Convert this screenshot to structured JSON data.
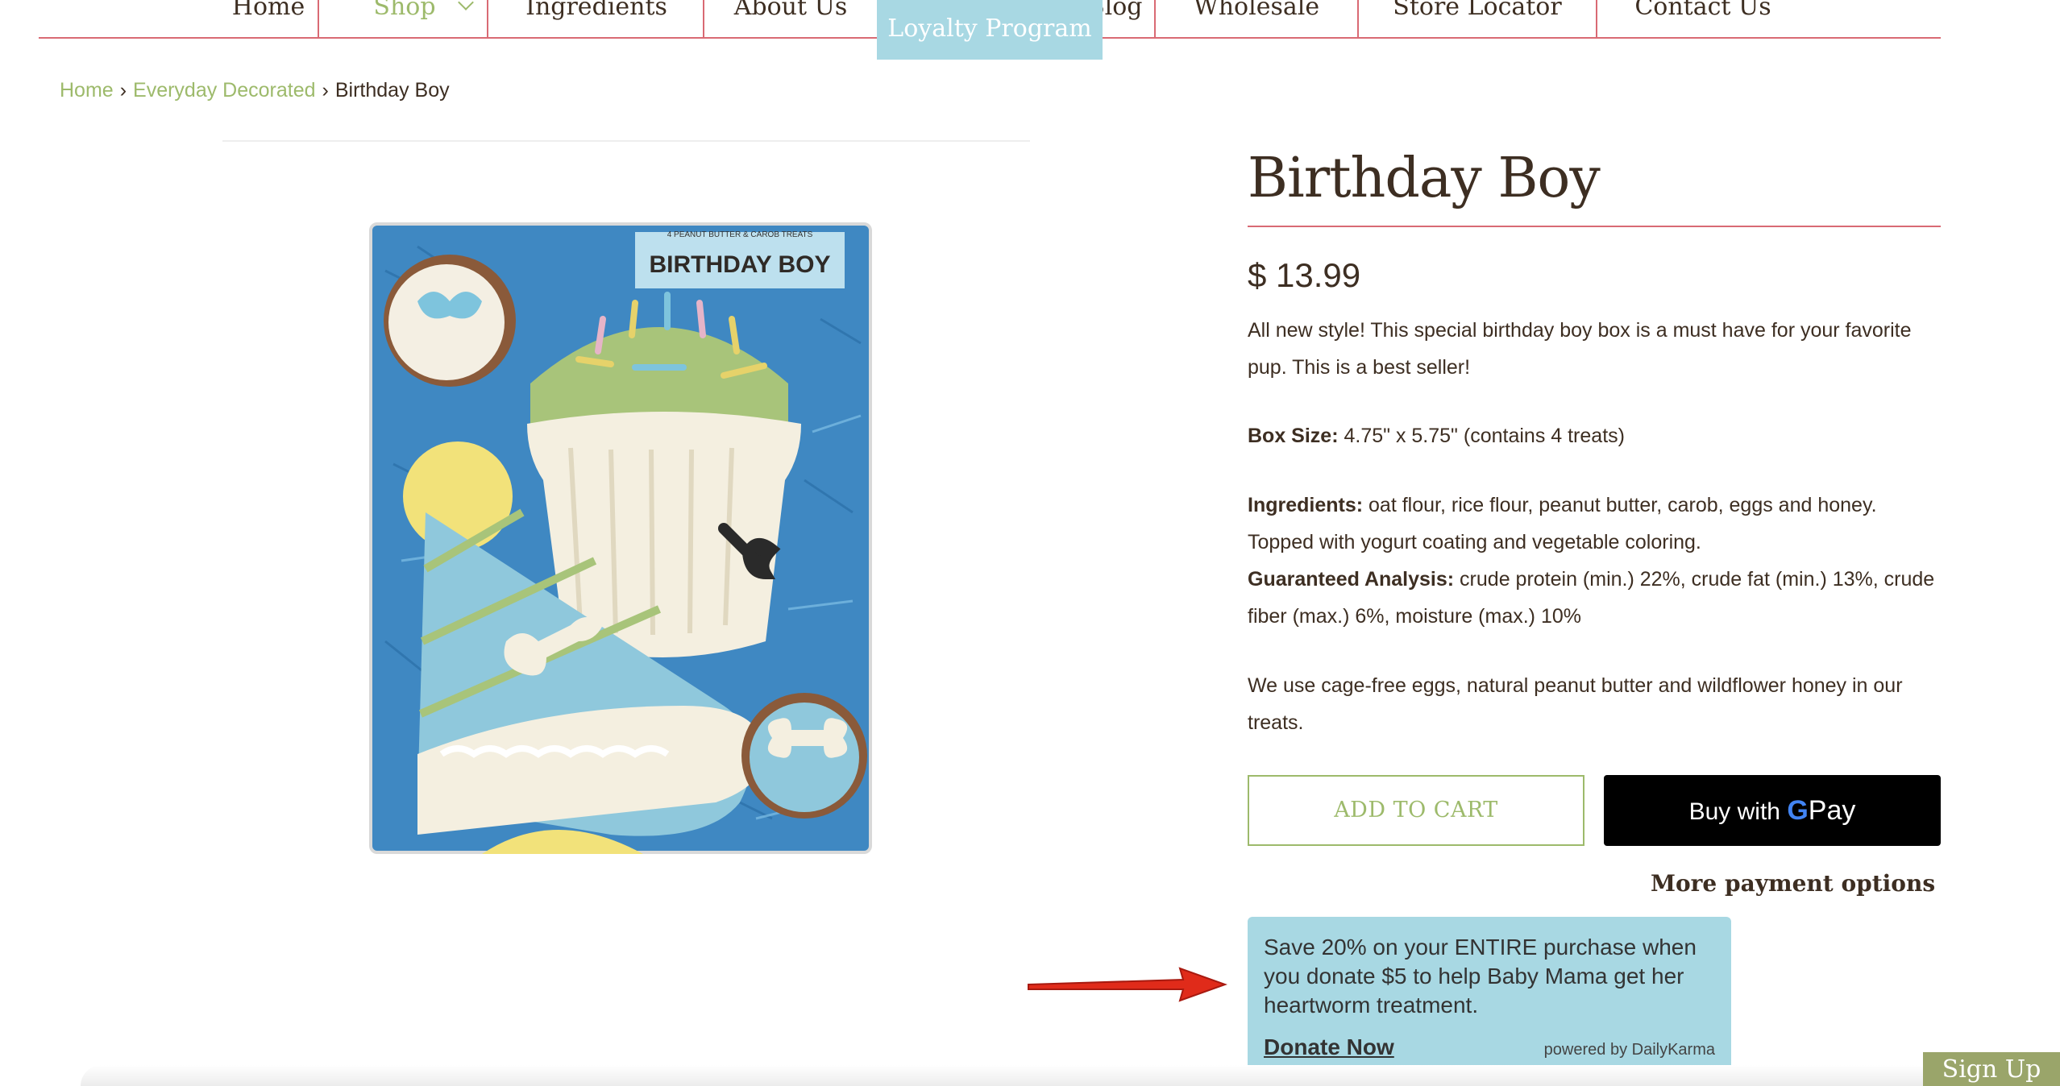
{
  "nav": {
    "items": [
      "Home",
      "Shop",
      "Ingredients",
      "About Us",
      "Blog",
      "Wholesale",
      "Store Locator",
      "Contact Us"
    ],
    "loyalty": "Loyalty Program"
  },
  "breadcrumb": {
    "home": "Home",
    "category": "Everyday Decorated",
    "current": "Birthday Boy"
  },
  "product": {
    "title": "Birthday Boy",
    "price": "$ 13.99",
    "description": "All new style! This special birthday boy box is a must have for your favorite pup. This is a best seller!",
    "box_size_label": "Box Size:",
    "box_size_value": " 4.75\" x 5.75\" (contains 4 treats)",
    "ingredients_label": "Ingredients:",
    "ingredients_value": " oat flour, rice flour, peanut butter, carob, eggs and honey. Topped with yogurt coating and vegetable coloring.",
    "analysis_label": "Guaranteed Analysis:",
    "analysis_value": " crude protein (min.) 22%, crude fat (min.) 13%, crude fiber (max.) 6%, moisture (max.) 10%",
    "note": "We use cage-free eggs, natural peanut butter and wildflower honey in our treats.",
    "image_box_label": "BIRTHDAY BOY",
    "image_box_sublabel": "4 PEANUT BUTTER & CAROB TREATS"
  },
  "buttons": {
    "add_to_cart": "ADD TO CART",
    "buy_with": "Buy with",
    "g": "G",
    "pay": "Pay",
    "more_payment": "More payment options"
  },
  "karma": {
    "text": "Save 20% on your ENTIRE purchase when you donate $5 to help Baby Mama get her heartworm treatment.",
    "link": "Donate Now",
    "powered": "powered by DailyKarma"
  },
  "signup": "Sign Up",
  "colors": {
    "accent_green": "#9dba6b",
    "rule_red": "#d96a74",
    "karma_blue": "#a8d8e3",
    "text_brown": "#3d2e22"
  }
}
